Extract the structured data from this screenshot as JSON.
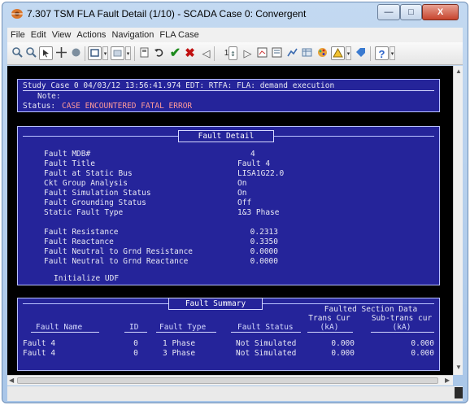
{
  "window": {
    "title": "7.307 TSM FLA Fault Detail (1/10) - SCADA Case 0: Convergent",
    "minimize": "—",
    "maximize": "□",
    "close": "X"
  },
  "menu": [
    "File",
    "Edit",
    "View",
    "Actions",
    "Navigation",
    "FLA Case"
  ],
  "toolbar": {
    "icons": {
      "zoom_in": "🔍",
      "zoom_out": "🔍",
      "select": "⬚",
      "pan": "✛",
      "record": "●",
      "check": "✔",
      "cross": "✖",
      "back": "◁",
      "forward": "▷"
    },
    "page_value": "1"
  },
  "header": {
    "study_case": "Study Case   0  04/03/12 13:56:41.974 EDT: RTFA: FLA: demand execution",
    "note_label": "Note:",
    "status_label": "Status:",
    "status_value": "CASE ENCOUNTERED FATAL ERROR"
  },
  "fault_detail": {
    "heading": "Fault Detail",
    "rows": [
      {
        "label": "Fault MDB#",
        "value": "4"
      },
      {
        "label": "Fault Title",
        "value": "Fault  4"
      },
      {
        "label": "Fault at Static Bus",
        "value": "LISA1G22.0"
      },
      {
        "label": "Ckt Group Analysis",
        "value": "On"
      },
      {
        "label": "Fault Simulation Status",
        "value": "On"
      },
      {
        "label": "Fault Grounding Status",
        "value": "Off"
      },
      {
        "label": "Static Fault Type",
        "value": "1&3 Phase"
      }
    ],
    "impedance": [
      {
        "label": "Fault Resistance",
        "value": "0.2313"
      },
      {
        "label": "Fault Reactance",
        "value": "0.3350"
      },
      {
        "label": "Fault Neutral to Grnd Resistance",
        "value": "0.0000"
      },
      {
        "label": "Fault Neutral to Grnd Reactance",
        "value": "0.0000"
      }
    ],
    "initialize": "Initialize UDF"
  },
  "fault_summary": {
    "heading": "Fault Summary",
    "group_header": "Faulted Section Data",
    "columns": {
      "name": "Fault Name",
      "id": "ID",
      "type": "Fault Type",
      "status": "Fault Status",
      "trans_top": "Trans Cur",
      "trans_unit": "(kA)",
      "sub_top": "Sub-trans cur",
      "sub_unit": "(kA)"
    },
    "rows": [
      {
        "name": "Fault  4",
        "id": "0",
        "type": "1 Phase",
        "status": "Not Simulated",
        "trans": "0.000",
        "sub": "0.000"
      },
      {
        "name": "Fault  4",
        "id": "0",
        "type": "3 Phase",
        "status": "Not Simulated",
        "trans": "0.000",
        "sub": "0.000"
      }
    ]
  }
}
